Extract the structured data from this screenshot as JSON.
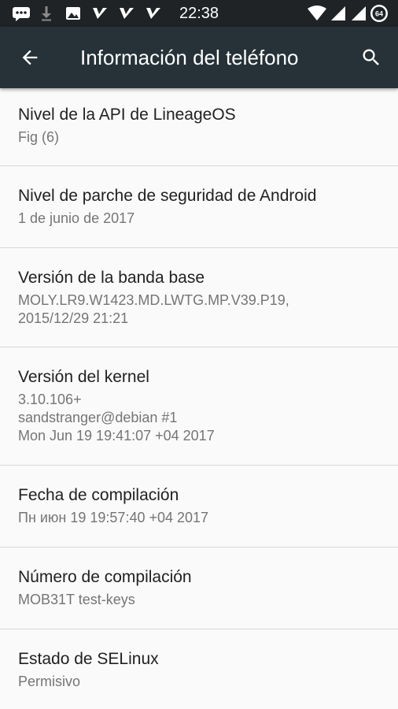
{
  "status_bar": {
    "time": "22:38",
    "battery_level": "64",
    "icons": [
      "messages-icon",
      "download-icon",
      "gallery-icon",
      "notification-icon",
      "notification-icon",
      "notification-icon",
      "wifi-icon",
      "signal-icon",
      "signal-icon",
      "battery-icon"
    ]
  },
  "app_bar": {
    "title": "Información del teléfono",
    "back_icon": "arrow-back-icon",
    "search_icon": "search-icon",
    "background": "#263238"
  },
  "items": [
    {
      "title": "Nivel de la API de LineageOS",
      "summary": "Fig (6)"
    },
    {
      "title": "Nivel de parche de seguridad de Android",
      "summary": "1 de junio de 2017"
    },
    {
      "title": "Versión de la banda base",
      "summary": "MOLY.LR9.W1423.MD.LWTG.MP.V39.P19,\n2015/12/29 21:21"
    },
    {
      "title": "Versión del kernel",
      "summary": "3.10.106+\nsandstranger@debian #1\nMon Jun 19 19:41:07 +04 2017"
    },
    {
      "title": "Fecha de compilación",
      "summary": "Пн июн 19 19:57:40 +04 2017"
    },
    {
      "title": "Número de compilación",
      "summary": "MOB31T test-keys"
    },
    {
      "title": "Estado de SELinux",
      "summary": "Permisivo"
    }
  ]
}
